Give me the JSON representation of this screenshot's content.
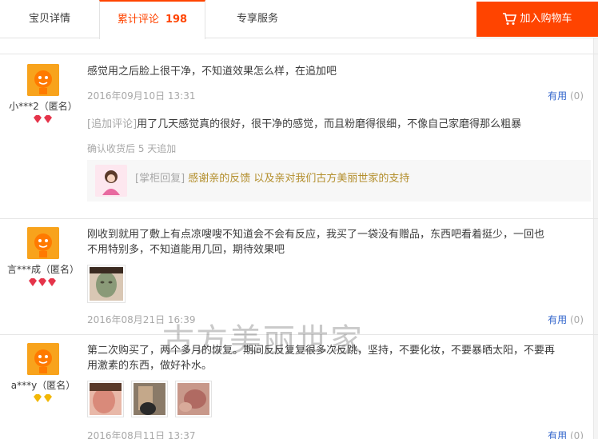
{
  "tabs": {
    "details": "宝贝详情",
    "reviews": "累计评论",
    "review_count": "198",
    "service": "专享服务"
  },
  "cart": {
    "label": "加入购物车"
  },
  "colors": {
    "accent": "#ff4400",
    "link": "#3366cc",
    "reply": "#b38e2c"
  },
  "reviews": [
    {
      "user": "小***2（匿名）",
      "rank_icon": "red-diamond-icon",
      "rank_count": 2,
      "text": "感觉用之后脸上很干净，不知道效果怎么样，在追加吧",
      "date": "2016年09月10日 13:31",
      "useful_label": "有用",
      "useful_count": "(0)",
      "append_tag": "[追加评论]",
      "append_text": "用了几天感觉真的很好，很干净的感觉，而且粉磨得很细，不像自己家磨得那么粗暴",
      "append_meta": "确认收货后 5 天追加",
      "reply_tag": "[掌柜回复]",
      "reply_text": "感谢亲的反馈 以及亲对我们古方美丽世家的支持"
    },
    {
      "user": "言***成（匿名）",
      "rank_icon": "red-diamond-icon",
      "rank_count": 3,
      "text_line1": "刚收到就用了敷上有点凉嗖嗖不知道会不会有反应，我买了一袋没有赠品，东西吧看着挺少，一回也",
      "text_line2": "不用特别多，不知道能用几回，期待效果吧",
      "date": "2016年08月21日 16:39",
      "useful_label": "有用",
      "useful_count": "(0)"
    },
    {
      "user": "a***y（匿名）",
      "rank_icon": "gold-diamond-icon",
      "rank_count": 2,
      "text_line1": "第二次购买了，两个多月的恢复。期间反反复复很多次反跳，坚持，不要化妆，不要暴晒太阳，不要再",
      "text_line2": "用激素的东西，做好补水。",
      "date": "2016年08月11日 13:37",
      "useful_label": "有用",
      "useful_count": "(0)"
    }
  ],
  "watermark": "古方美丽世家"
}
